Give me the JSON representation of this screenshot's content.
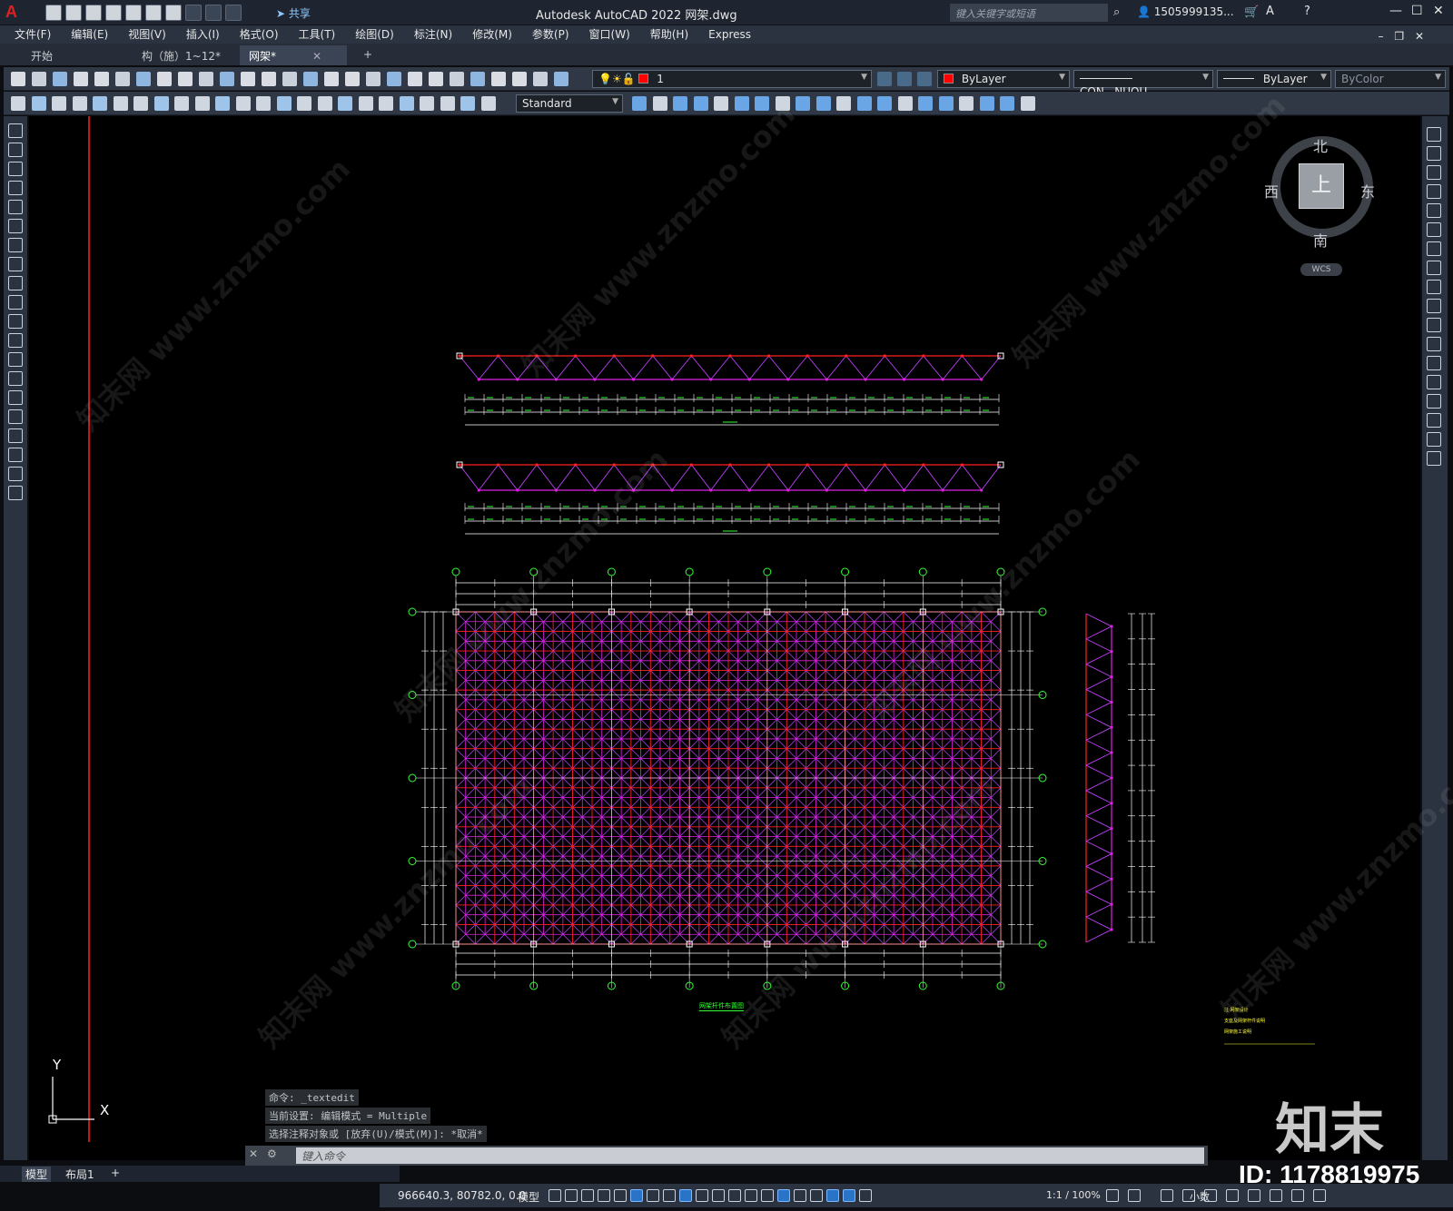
{
  "titlebar": {
    "app_title": "Autodesk AutoCAD 2022    网架.dwg",
    "share": "共享",
    "search_placeholder": "键入关键字或短语",
    "user": "1505999135...",
    "logo": "A"
  },
  "menu": [
    "文件(F)",
    "编辑(E)",
    "视图(V)",
    "插入(I)",
    "格式(O)",
    "工具(T)",
    "绘图(D)",
    "标注(N)",
    "修改(M)",
    "参数(P)",
    "窗口(W)",
    "帮助(H)",
    "Express"
  ],
  "tabs": [
    {
      "label": "开始"
    },
    {
      "label": "构（施）1~12*"
    },
    {
      "label": "网架*"
    }
  ],
  "toolbar": {
    "layer_value": "1",
    "color_value": "ByLayer",
    "linetype_value": "CON...NUOU",
    "lineweight_value": "ByLayer",
    "plotstyle_value": "ByColor",
    "textstyle_value": "Standard"
  },
  "viewcube": {
    "north": "北",
    "south": "南",
    "east": "东",
    "west": "西",
    "top": "上",
    "wcs": "WCS"
  },
  "ucs": {
    "x": "X",
    "y": "Y"
  },
  "command": {
    "history": [
      "命令: _textedit",
      "当前设置: 编辑模式 = Multiple",
      "选择注释对象或 [放弃(U)/模式(M)]: *取消*"
    ],
    "input_placeholder": "键入命令"
  },
  "layout_tabs": [
    "模型",
    "布局1"
  ],
  "statusbar": {
    "coords": "966640.3, 80782.0, 0.0",
    "model": "模型",
    "scale": "1:1 / 100%",
    "units": "小数"
  },
  "watermark": {
    "logo": "知末",
    "id": "ID: 1178819975",
    "text": "知末网 www.znzmo.com"
  },
  "drawing": {
    "plan_title": "网架杆件布置图",
    "note_lines": [
      "注:网架设计",
      "支座及网架杆件说明",
      "网架施工说明"
    ],
    "colors": {
      "top_chord": "#ff2020",
      "bottom_chord": "#e020e0",
      "web": "#c040ff",
      "dim": "#ffffff",
      "dimtext": "#33ff33",
      "axis": "#33ff33"
    }
  }
}
